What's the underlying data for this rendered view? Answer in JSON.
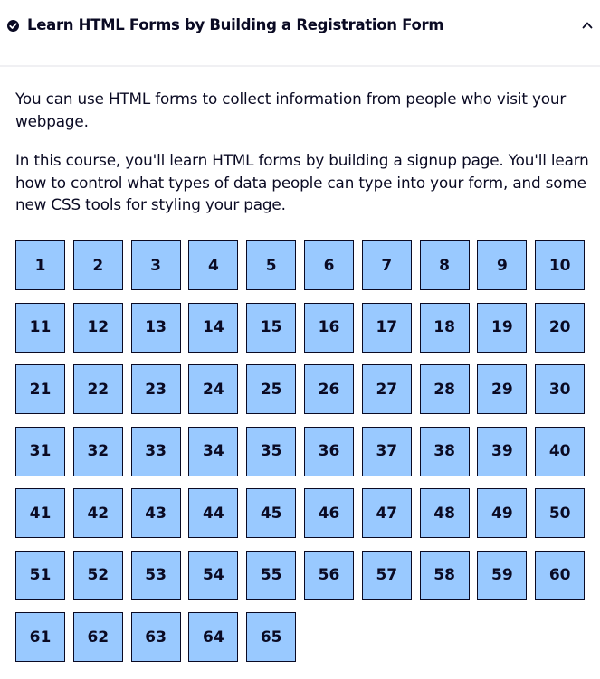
{
  "header": {
    "title": "Learn HTML Forms by Building a Registration Form",
    "completed_icon": "check-circle-icon",
    "collapse_icon": "chevron-up-icon"
  },
  "intro": {
    "paragraph_1": "You can use HTML forms to collect information from people who visit your webpage.",
    "paragraph_2": "In this course, you'll learn HTML forms by building a signup page. You'll learn how to control what types of data people can type into your form, and some new CSS tools for styling your page."
  },
  "steps": [
    "1",
    "2",
    "3",
    "4",
    "5",
    "6",
    "7",
    "8",
    "9",
    "10",
    "11",
    "12",
    "13",
    "14",
    "15",
    "16",
    "17",
    "18",
    "19",
    "20",
    "21",
    "22",
    "23",
    "24",
    "25",
    "26",
    "27",
    "28",
    "29",
    "30",
    "31",
    "32",
    "33",
    "34",
    "35",
    "36",
    "37",
    "38",
    "39",
    "40",
    "41",
    "42",
    "43",
    "44",
    "45",
    "46",
    "47",
    "48",
    "49",
    "50",
    "51",
    "52",
    "53",
    "54",
    "55",
    "56",
    "57",
    "58",
    "59",
    "60",
    "61",
    "62",
    "63",
    "64",
    "65"
  ],
  "colors": {
    "step_background": "#99c9ff",
    "text": "#0a0a23",
    "background": "#ffffff"
  }
}
